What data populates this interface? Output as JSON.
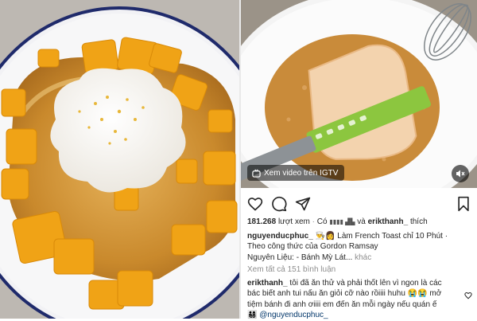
{
  "video": {
    "igtv_label": "Xem video trên IGTV"
  },
  "post": {
    "views_count": "181.268",
    "views_label": "lượt xem",
    "liked_by_prefix": "Có",
    "liked_by_hidden": "▮▮▮▮ ▟▙",
    "liked_by_connector": "và",
    "liked_by_user": "erikthanh_",
    "liked_by_suffix": "thích",
    "author": "nguyenducphuc_",
    "author_emoji": "👨‍🍳👩",
    "caption_line1": "Làm French Toast chỉ 10 Phút ·",
    "caption_line2": "Theo công thức của Gordon Ramsay",
    "caption_line3": "Nguyên Liệu: - Bánh Mỳ Lát...",
    "more_label": "khác",
    "view_comments": "Xem tất cả 151 bình luận"
  },
  "comment": {
    "user": "erikthanh_",
    "line1": "tôi đã ăn thử và phải thốt lên vì ngon là các",
    "line2": "bác biết anh tui nấu ăn giỏi cỡ nào rồiiii huhu 😭😭 mở",
    "line3": "tiệm bánh đi anh ơiiii em đến ăn mỗi ngày nếu quán ế",
    "line4_emoji": "👨‍👩‍👧‍👦",
    "mention": "@nguyenducphuc_"
  },
  "colors": {
    "link": "#003569",
    "grey": "#8e8e8e",
    "text": "#262626"
  }
}
